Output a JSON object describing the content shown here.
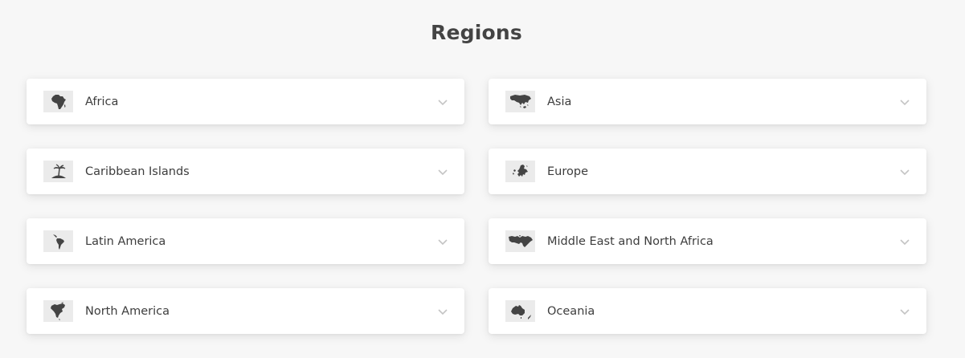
{
  "page": {
    "title": "Regions"
  },
  "regions": [
    {
      "label": "Africa",
      "icon": "africa-map-icon"
    },
    {
      "label": "Asia",
      "icon": "asia-map-icon"
    },
    {
      "label": "Caribbean Islands",
      "icon": "palm-island-icon"
    },
    {
      "label": "Europe",
      "icon": "europe-map-icon"
    },
    {
      "label": "Latin America",
      "icon": "latin-america-map-icon"
    },
    {
      "label": "Middle East and North Africa",
      "icon": "mena-map-icon"
    },
    {
      "label": "North America",
      "icon": "north-america-map-icon"
    },
    {
      "label": "Oceania",
      "icon": "oceania-map-icon"
    }
  ],
  "colors": {
    "background": "#f7f7f7",
    "card": "#ffffff",
    "icon_fill": "#444444",
    "icon_bg": "#ebebeb",
    "chevron": "#c4c4c4"
  }
}
